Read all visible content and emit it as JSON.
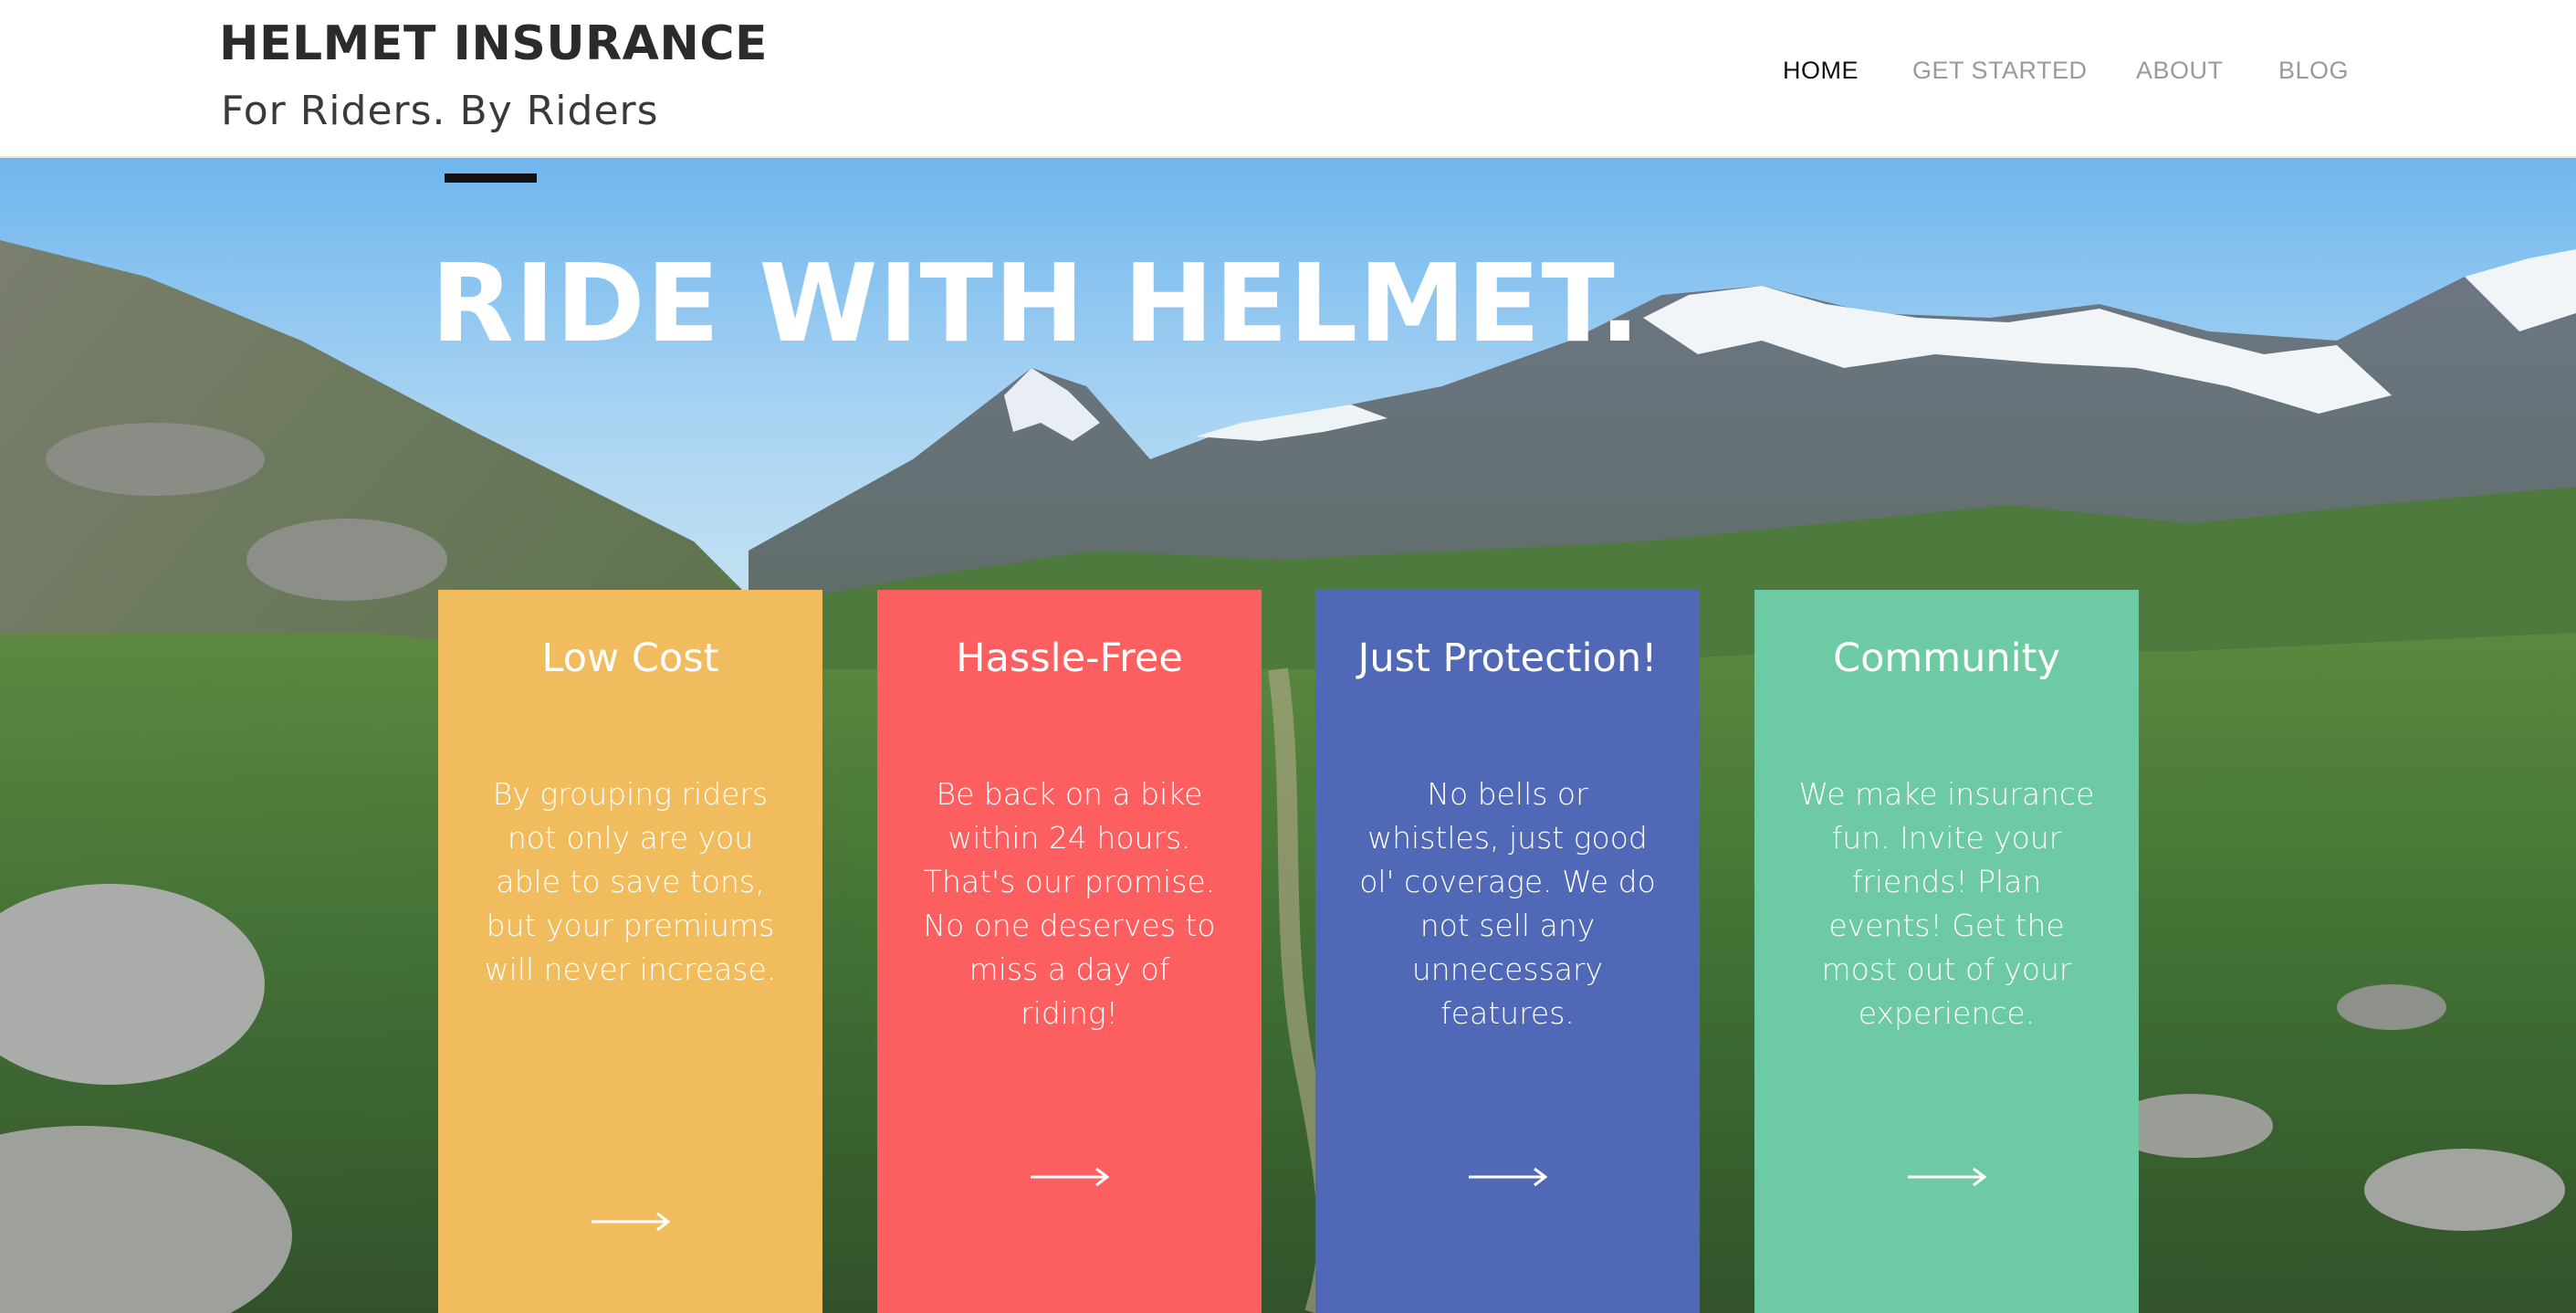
{
  "header": {
    "brand_title": "HELMET INSURANCE",
    "tagline": "For Riders. By Riders"
  },
  "nav": {
    "items": [
      {
        "label": "HOME",
        "active": true
      },
      {
        "label": "GET STARTED",
        "active": false
      },
      {
        "label": "ABOUT",
        "active": false
      },
      {
        "label": "BLOG",
        "active": false
      }
    ]
  },
  "hero": {
    "title": "RIDE WITH HELMET.",
    "background": "mountain-landscape-image"
  },
  "cards": [
    {
      "title": "Low Cost",
      "body": "By grouping riders not only are you able to save tons, but your premiums will never increase.",
      "color": "#f0bc5e",
      "icon": "arrow-right-icon"
    },
    {
      "title": "Hassle-Free",
      "body": "Be back on a bike within 24 hours. That's our promise. No one deserves to miss a day of riding!",
      "color": "#fd5e5f",
      "icon": "arrow-right-icon"
    },
    {
      "title": "Just Protection!",
      "body": "No bells or whistles, just good ol' coverage. We do not sell any unnecessary features.",
      "color": "#5068b5",
      "icon": "arrow-right-icon"
    },
    {
      "title": "Community",
      "body": "We make insurance fun. Invite your friends! Plan events! Get the most out of your experience.",
      "color": "#6ecaa4",
      "icon": "arrow-right-icon"
    }
  ]
}
